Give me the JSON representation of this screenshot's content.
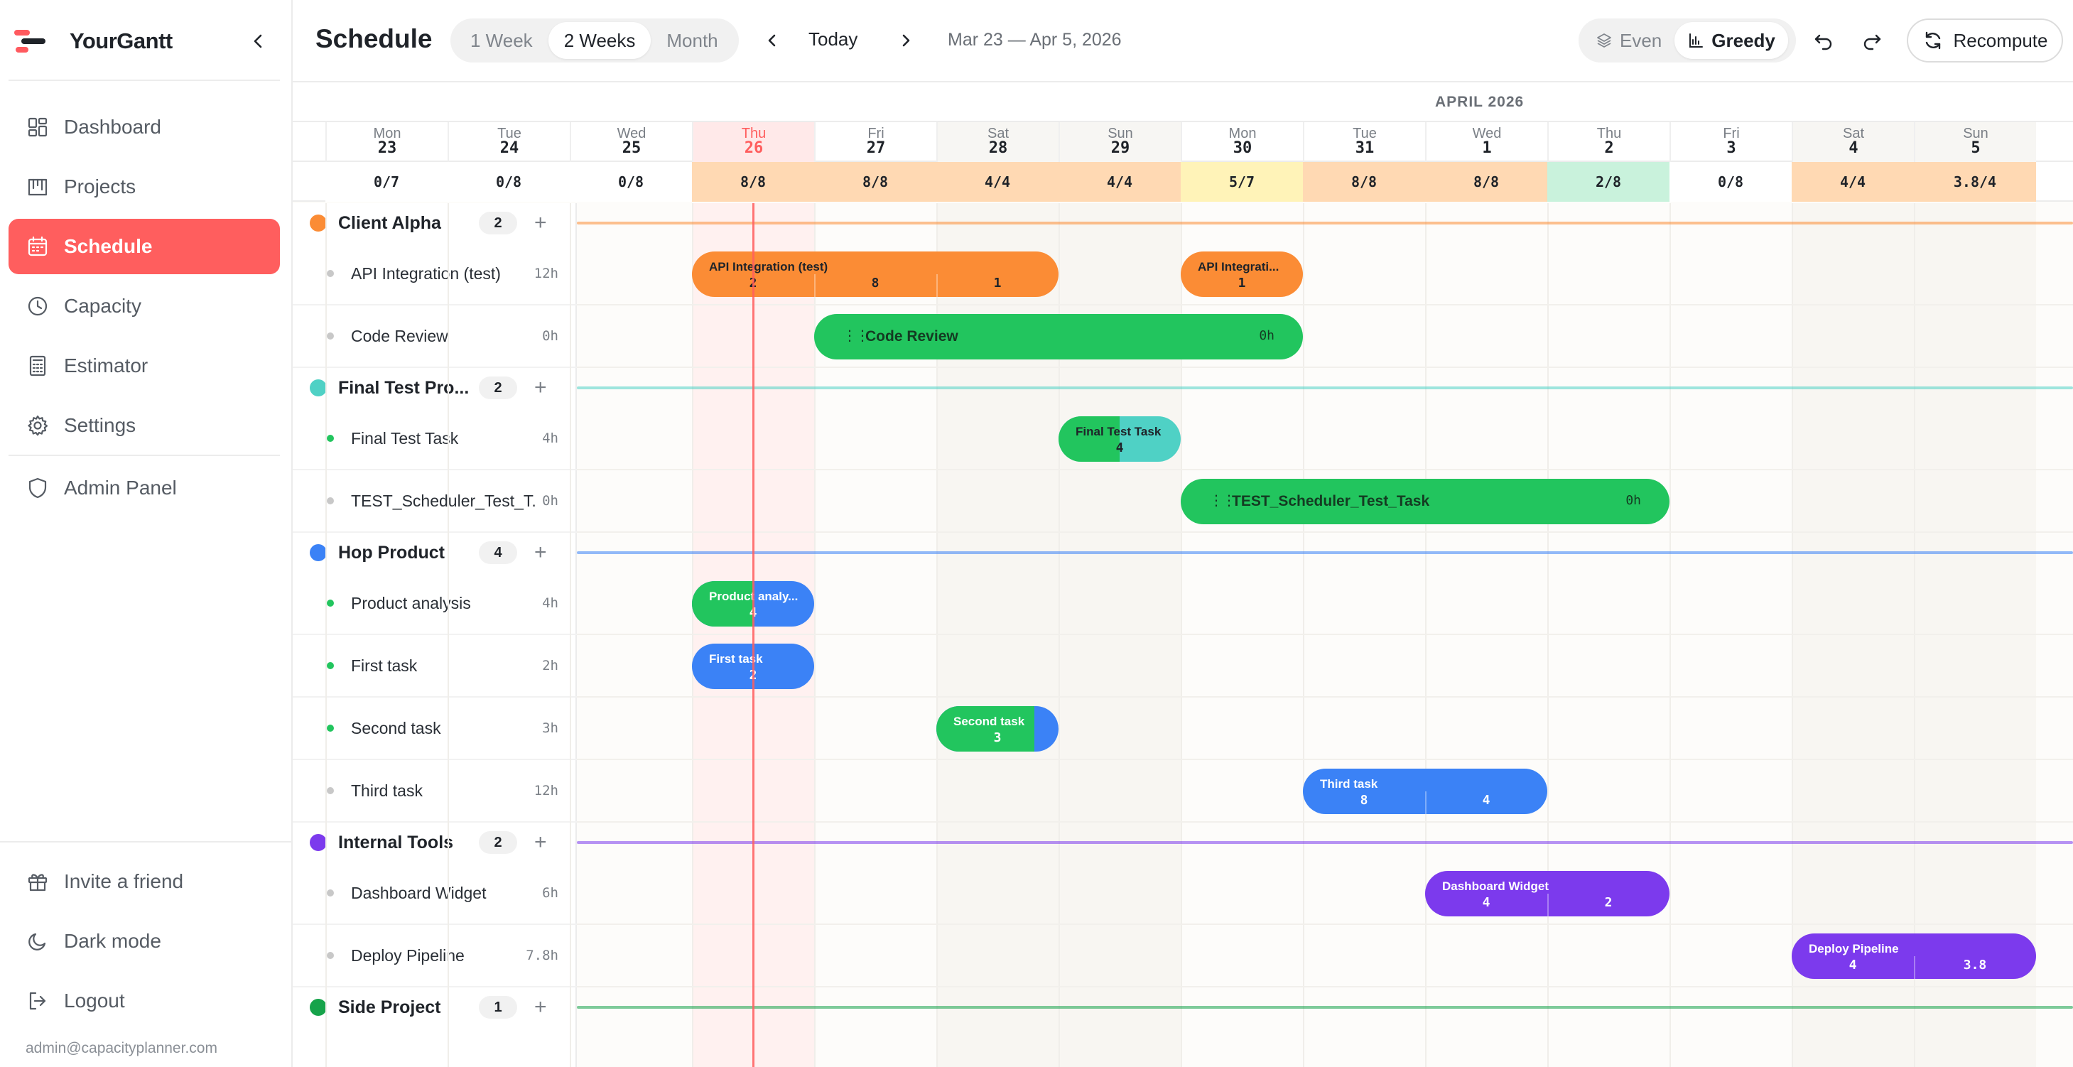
{
  "brand": {
    "name": "YourGantt"
  },
  "sidebar": {
    "items": [
      {
        "id": "dashboard",
        "label": "Dashboard",
        "icon": "dashboard-icon"
      },
      {
        "id": "projects",
        "label": "Projects",
        "icon": "projects-icon"
      },
      {
        "id": "schedule",
        "label": "Schedule",
        "icon": "calendar-icon",
        "active": true
      },
      {
        "id": "capacity",
        "label": "Capacity",
        "icon": "clock-icon"
      },
      {
        "id": "estimator",
        "label": "Estimator",
        "icon": "calculator-icon"
      },
      {
        "id": "settings",
        "label": "Settings",
        "icon": "gear-icon"
      },
      {
        "id": "admin",
        "label": "Admin Panel",
        "icon": "shield-icon"
      }
    ],
    "bottom": [
      {
        "id": "invite",
        "label": "Invite a friend",
        "icon": "gift-icon"
      },
      {
        "id": "dark",
        "label": "Dark mode",
        "icon": "moon-icon"
      },
      {
        "id": "logout",
        "label": "Logout",
        "icon": "logout-icon"
      }
    ],
    "email": "admin@capacityplanner.com"
  },
  "header": {
    "title": "Schedule",
    "ranges": [
      "1 Week",
      "2 Weeks",
      "Month"
    ],
    "active_range": "2 Weeks",
    "today_label": "Today",
    "date_range": "Mar 23 — Apr 5, 2026",
    "modes": [
      "Even",
      "Greedy"
    ],
    "active_mode": "Greedy",
    "recompute_label": "Recompute"
  },
  "calendar": {
    "month_label": "APRIL 2026",
    "days": [
      {
        "dn": "Mon",
        "dd": "23",
        "cap": "0/7",
        "cap_bg": "#ffffff"
      },
      {
        "dn": "Tue",
        "dd": "24",
        "cap": "0/8",
        "cap_bg": "#ffffff"
      },
      {
        "dn": "Wed",
        "dd": "25",
        "cap": "0/8",
        "cap_bg": "#ffffff"
      },
      {
        "dn": "Thu",
        "dd": "26",
        "cap": "8/8",
        "cap_bg": "#ffd9b3",
        "today": true
      },
      {
        "dn": "Fri",
        "dd": "27",
        "cap": "8/8",
        "cap_bg": "#ffd9b3"
      },
      {
        "dn": "Sat",
        "dd": "28",
        "cap": "4/4",
        "cap_bg": "#ffd9b3",
        "weekend": true
      },
      {
        "dn": "Sun",
        "dd": "29",
        "cap": "4/4",
        "cap_bg": "#ffd9b3",
        "weekend": true
      },
      {
        "dn": "Mon",
        "dd": "30",
        "cap": "5/7",
        "cap_bg": "#fff3b8"
      },
      {
        "dn": "Tue",
        "dd": "31",
        "cap": "8/8",
        "cap_bg": "#ffd9b3"
      },
      {
        "dn": "Wed",
        "dd": "1",
        "cap": "8/8",
        "cap_bg": "#ffd9b3"
      },
      {
        "dn": "Thu",
        "dd": "2",
        "cap": "2/8",
        "cap_bg": "#c9f2dc"
      },
      {
        "dn": "Fri",
        "dd": "3",
        "cap": "0/8",
        "cap_bg": "#ffffff"
      },
      {
        "dn": "Sat",
        "dd": "4",
        "cap": "4/4",
        "cap_bg": "#ffd9b3",
        "weekend": true
      },
      {
        "dn": "Sun",
        "dd": "5",
        "cap": "3.8/4",
        "cap_bg": "#ffd9b3",
        "weekend": true
      }
    ]
  },
  "colors": {
    "accent": "#ff5e5e",
    "orange": "#fb8c35",
    "green": "#22c55e",
    "teal": "#4fd1c5",
    "blue": "#3b82f6",
    "purple": "#7c3aed",
    "side": "#16a34a"
  },
  "projects": [
    {
      "name": "Client Alpha",
      "count": "2",
      "color": "#fb8c35",
      "tasks": [
        {
          "name": "API Integration (test)",
          "hours": "12h",
          "dot": "#c8c8c8",
          "bars": [
            {
              "label": "API Integration (test)",
              "start": 3,
              "days": 3,
              "values": [
                "2",
                "8",
                "1"
              ],
              "color": "#fb8c35",
              "style": "split",
              "dark": true
            },
            {
              "label": "API Integrati...",
              "start": 7,
              "days": 1,
              "values": [
                "1"
              ],
              "color": "#fb8c35",
              "style": "split",
              "dark": true
            }
          ]
        },
        {
          "name": "Code Review",
          "hours": "0h",
          "dot": "#c8c8c8",
          "bars": [
            {
              "label": "Code Review",
              "start": 4,
              "days": 4,
              "hours": "0h",
              "color": "#22c55e",
              "style": "solid"
            }
          ]
        }
      ]
    },
    {
      "name": "Final Test Pro...",
      "count": "2",
      "color": "#4fd1c5",
      "tasks": [
        {
          "name": "Final Test Task",
          "hours": "4h",
          "dot": "#22c55e",
          "bars": [
            {
              "label": "Final Test Task",
              "start": 6,
              "days": 1,
              "values": [
                "4"
              ],
              "color": "#4fd1c5",
              "fill": "#22c55e",
              "fill_frac": 0.5,
              "style": "split",
              "dark": true
            }
          ]
        },
        {
          "name": "TEST_Scheduler_Test_T...",
          "hours": "0h",
          "dot": "#c8c8c8",
          "bars": [
            {
              "label": "TEST_Scheduler_Test_Task",
              "start": 7,
              "days": 4,
              "hours": "0h",
              "color": "#22c55e",
              "style": "solid"
            }
          ]
        }
      ]
    },
    {
      "name": "Hop Product",
      "count": "4",
      "color": "#3b82f6",
      "tasks": [
        {
          "name": "Product analysis",
          "hours": "4h",
          "dot": "#22c55e",
          "bars": [
            {
              "label": "Product analy...",
              "start": 3,
              "days": 1,
              "values": [
                "4"
              ],
              "color": "#3b82f6",
              "fill": "#22c55e",
              "fill_frac": 0.5,
              "style": "split"
            }
          ]
        },
        {
          "name": "First task",
          "hours": "2h",
          "dot": "#22c55e",
          "bars": [
            {
              "label": "First task",
              "start": 3,
              "days": 1,
              "values": [
                "2"
              ],
              "color": "#3b82f6",
              "style": "split"
            }
          ]
        },
        {
          "name": "Second task",
          "hours": "3h",
          "dot": "#22c55e",
          "bars": [
            {
              "label": "Second task",
              "start": 5,
              "days": 1,
              "values": [
                "3"
              ],
              "color": "#3b82f6",
              "fill": "#22c55e",
              "fill_frac": 0.8,
              "style": "split"
            }
          ]
        },
        {
          "name": "Third task",
          "hours": "12h",
          "dot": "#c8c8c8",
          "bars": [
            {
              "label": "Third task",
              "start": 8,
              "days": 2,
              "values": [
                "8",
                "4"
              ],
              "color": "#3b82f6",
              "style": "split"
            }
          ]
        }
      ]
    },
    {
      "name": "Internal Tools",
      "count": "2",
      "color": "#7c3aed",
      "tasks": [
        {
          "name": "Dashboard Widget",
          "hours": "6h",
          "dot": "#c8c8c8",
          "bars": [
            {
              "label": "Dashboard Widget",
              "start": 9,
              "days": 2,
              "values": [
                "4",
                "2"
              ],
              "color": "#7c3aed",
              "style": "split"
            }
          ]
        },
        {
          "name": "Deploy Pipeline",
          "hours": "7.8h",
          "dot": "#c8c8c8",
          "bars": [
            {
              "label": "Deploy Pipeline",
              "start": 12,
              "days": 2,
              "values": [
                "4",
                "3.8"
              ],
              "color": "#7c3aed",
              "style": "split"
            }
          ]
        }
      ]
    },
    {
      "name": "Side Project",
      "count": "1",
      "color": "#16a34a",
      "tasks": []
    }
  ]
}
